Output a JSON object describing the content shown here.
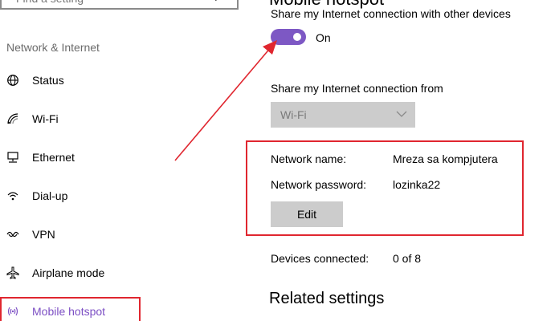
{
  "search": {
    "placeholder": "Find a setting"
  },
  "sidebar": {
    "section_title": "Network & Internet",
    "items": [
      {
        "label": "Status",
        "icon": "globe-icon"
      },
      {
        "label": "Wi-Fi",
        "icon": "wifi-icon"
      },
      {
        "label": "Ethernet",
        "icon": "ethernet-icon"
      },
      {
        "label": "Dial-up",
        "icon": "dialup-icon"
      },
      {
        "label": "VPN",
        "icon": "vpn-icon"
      },
      {
        "label": "Airplane mode",
        "icon": "airplane-icon"
      },
      {
        "label": "Mobile hotspot",
        "icon": "hotspot-icon",
        "active": true
      }
    ]
  },
  "main": {
    "heading": "Mobile hotspot",
    "share_label": "Share my Internet connection with other devices",
    "toggle_state": "On",
    "from_label": "Share my Internet connection from",
    "from_value": "Wi-Fi",
    "network_name_label": "Network name:",
    "network_name_value": "Mreza sa kompjutera",
    "network_password_label": "Network password:",
    "network_password_value": "lozinka22",
    "edit_button": "Edit",
    "devices_label": "Devices connected:",
    "devices_value": "0 of 8",
    "related_heading": "Related settings"
  },
  "colors": {
    "accent": "#7d58c4",
    "annotation_red": "#e0262f"
  }
}
